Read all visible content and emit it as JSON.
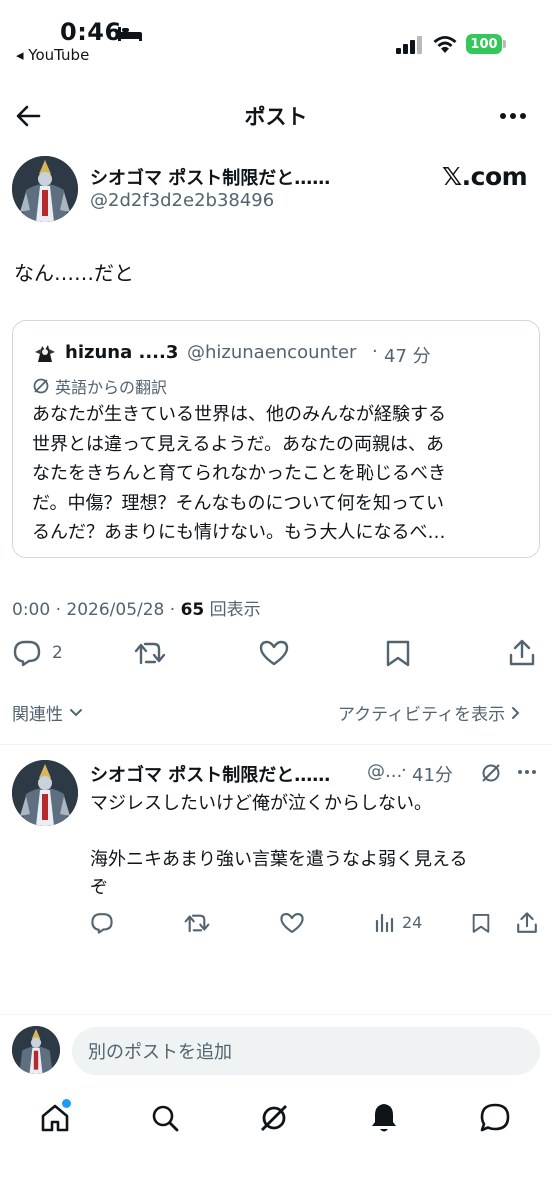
{
  "status_bar": {
    "time": "0:46",
    "back_app": "◂ YouTube",
    "battery": "100"
  },
  "header": {
    "title": "ポスト"
  },
  "post": {
    "author_name": "シオゴマ ポスト制限だと……",
    "author_handle": "@2d2f3d2e2b38496",
    "watermark": "𝕏.com",
    "text": "なん……だと",
    "quote": {
      "author_name": "hizuna ....3",
      "author_handle": "@hizunaencounter",
      "separator": "·",
      "time": "47 分",
      "translation_label": "英語からの翻訳",
      "text": "あなたが生きている世界は、他のみんなが経験する\n世界とは違って見えるようだ。あなたの両親は、あ\nなたをきちんと育てられなかったことを恥じるべき\nだ。中傷？理想？そんなものについて何を知ってい\nるんだ？あまりにも情けない。もう大人になるべ…"
    },
    "meta": {
      "time_date": "0:00 · 2026/05/28 · ",
      "views": "65",
      "views_label": " 回表示"
    },
    "actions": {
      "reply_count": "2"
    }
  },
  "sort": {
    "label": "関連性",
    "activity_label": "アクティビティを表示"
  },
  "reply": {
    "author_name": "シオゴマ ポスト制限だと……",
    "author_handle": "@...",
    "separator": "·",
    "time": "41分",
    "text": "マジレスしたいけど俺が泣くからしない。\n\n海外ニキあまり強い言葉を遣うなよ弱く見える\nぞ",
    "views": "24"
  },
  "composer": {
    "placeholder": "別のポストを追加"
  },
  "icons": {
    "back": "arrow-left-icon",
    "more": "more-horizontal-icon",
    "reply": "comment-icon",
    "retweet": "repost-icon",
    "like": "heart-icon",
    "bookmark": "bookmark-icon",
    "share": "share-icon",
    "views": "analytics-icon",
    "home": "home-icon",
    "search": "search-icon",
    "grok": "grok-icon",
    "notifications": "bell-icon",
    "messages": "message-icon"
  },
  "colors": {
    "text": "#0f1419",
    "muted": "#536471",
    "accent": "#1d9bf0",
    "battery": "#34c759",
    "border": "#cfd9de"
  }
}
